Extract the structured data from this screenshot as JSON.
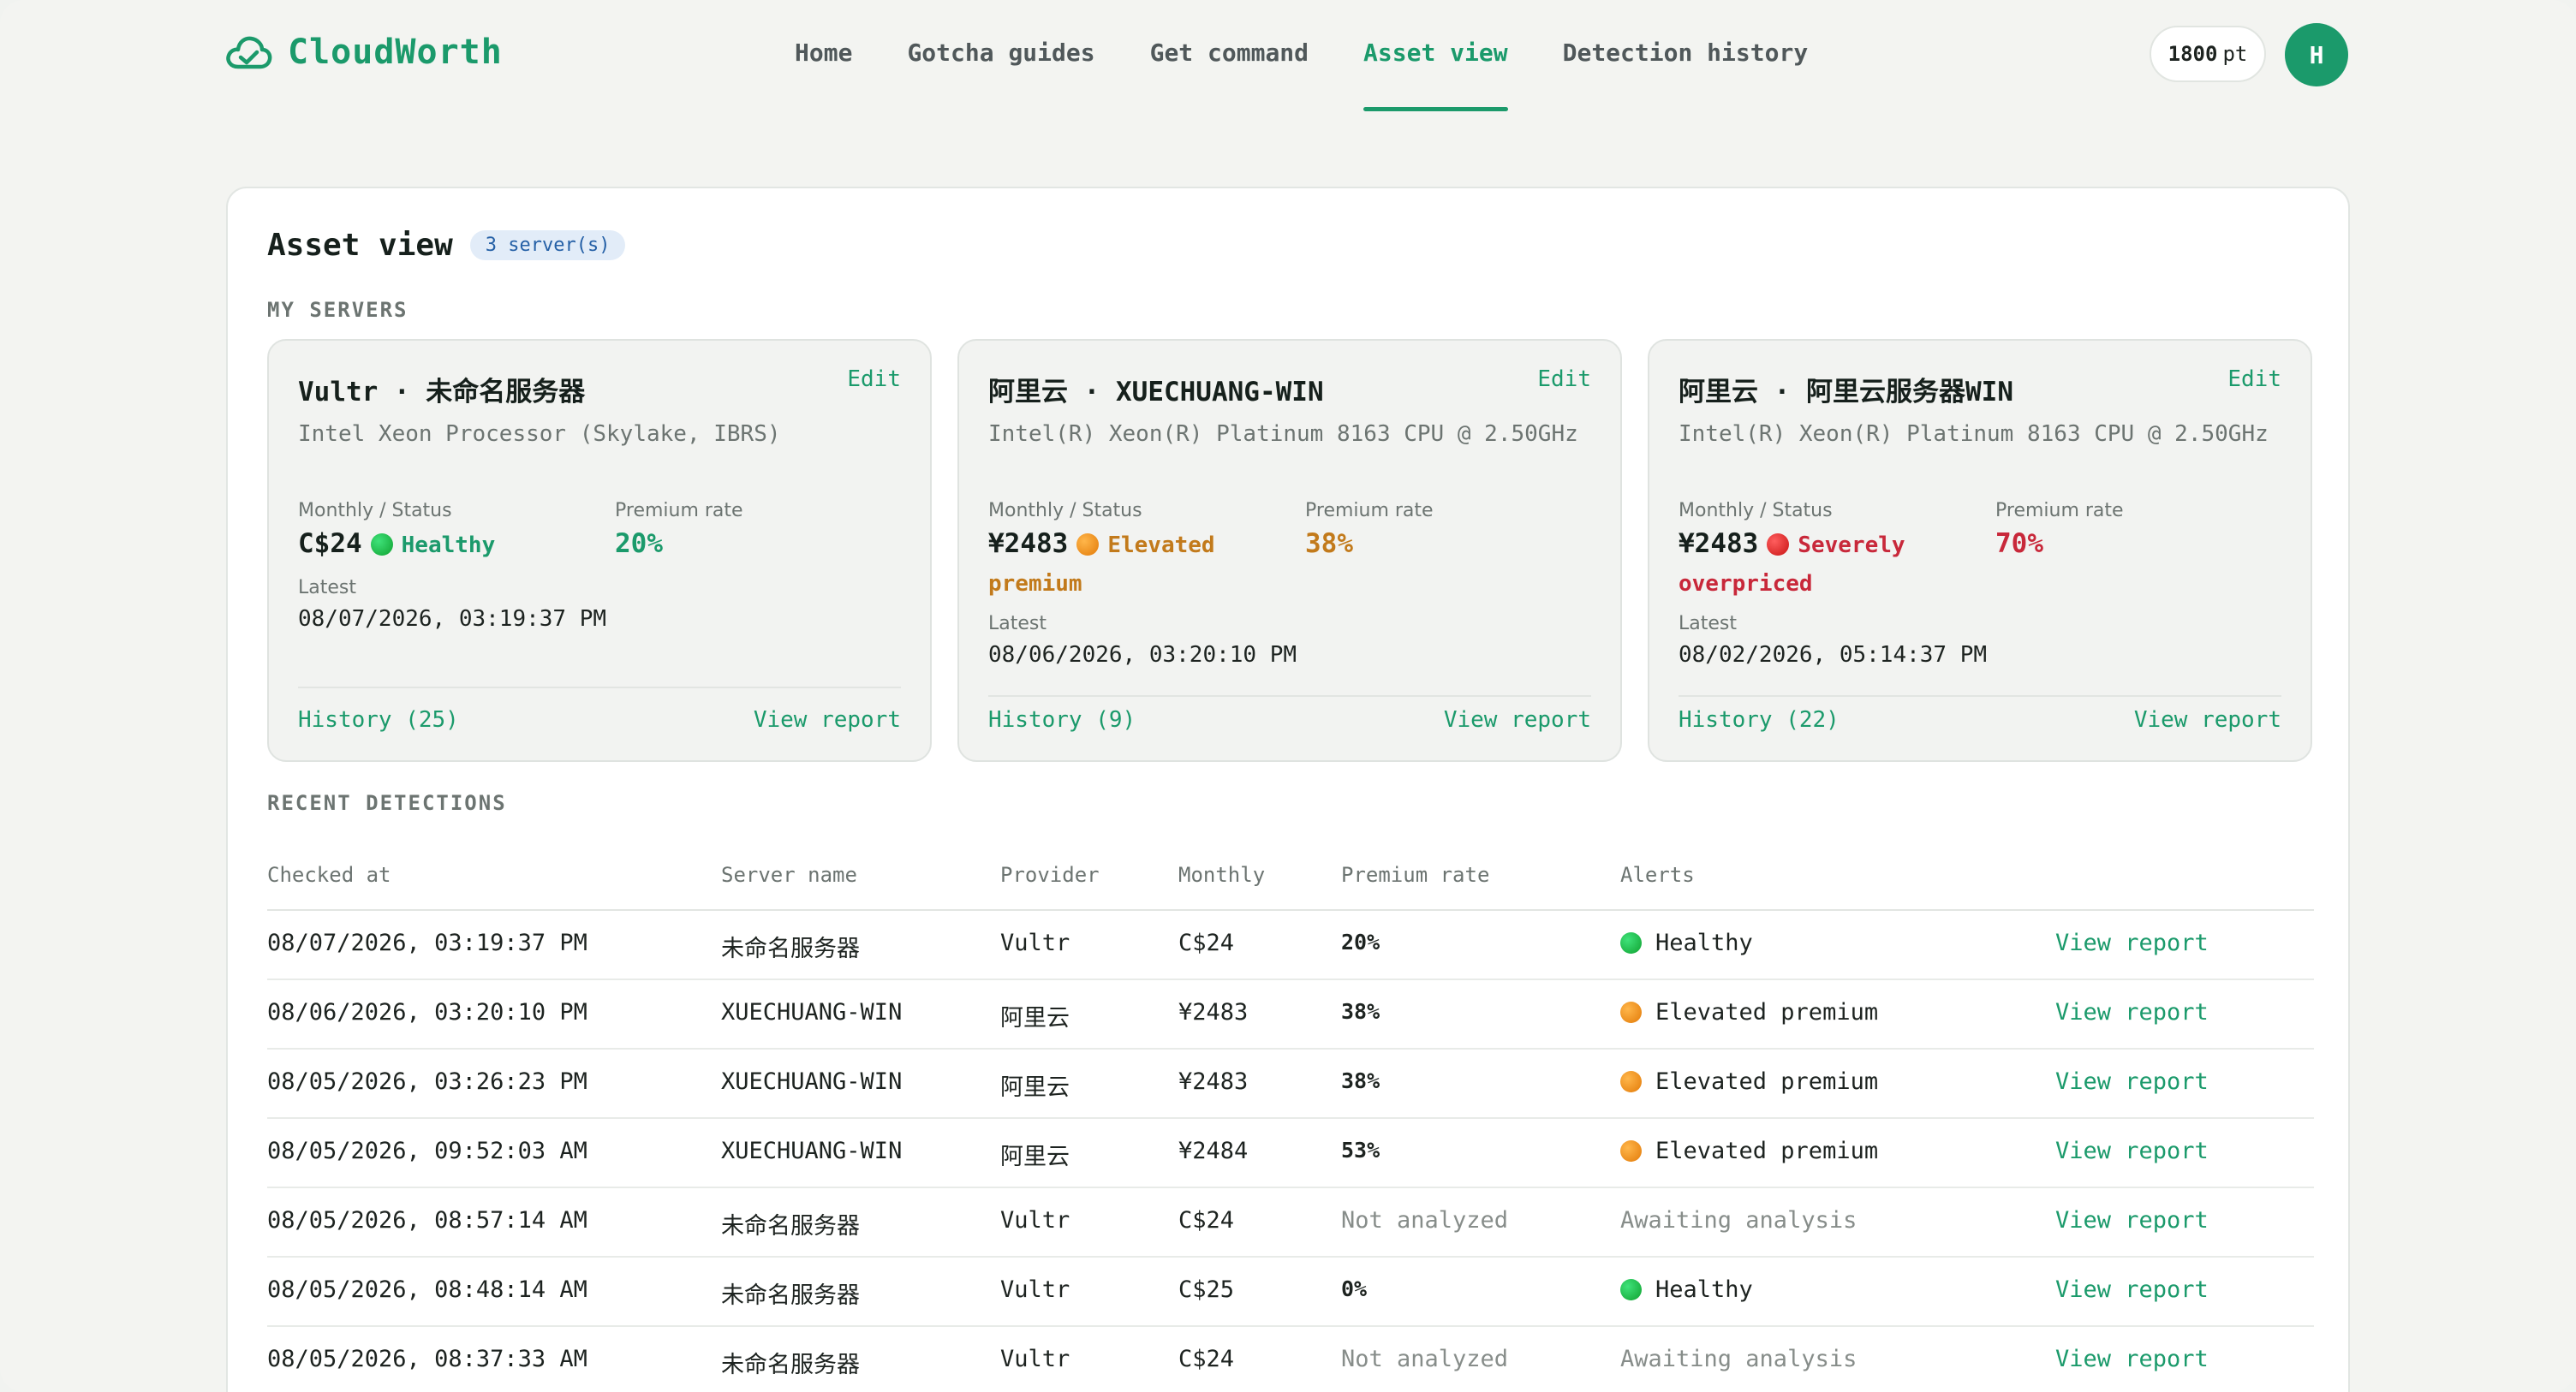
{
  "brand": {
    "name": "CloudWorth",
    "icon": "cloud-check-icon"
  },
  "nav": {
    "items": [
      {
        "label": "Home"
      },
      {
        "label": "Gotcha guides"
      },
      {
        "label": "Get command"
      },
      {
        "label": "Asset view",
        "active": true
      },
      {
        "label": "Detection history"
      }
    ]
  },
  "user": {
    "points": "1800",
    "points_unit": "pt",
    "avatar_initial": "H"
  },
  "page": {
    "title": "Asset view",
    "server_count": "3 server(s)",
    "my_servers_label": "MY SERVERS",
    "recent_label": "RECENT DETECTIONS"
  },
  "colors": {
    "accent": "#1b9a6b",
    "healthy": "#1b9a6b",
    "elevated": "#c27a1b",
    "severe": "#c8283a"
  },
  "labels": {
    "monthly_status": "Monthly / Status",
    "premium_rate": "Premium rate",
    "latest": "Latest",
    "edit": "Edit",
    "view_report": "View report"
  },
  "servers": [
    {
      "title": "Vultr · 未命名服务器",
      "cpu": "Intel Xeon Processor (Skylake, IBRS)",
      "price": "C$24",
      "status_line1": "Healthy",
      "status_line2": "",
      "status_level": "healthy",
      "premium_rate": "20%",
      "latest": "08/07/2026, 03:19:37 PM",
      "history": "History (25)"
    },
    {
      "title": "阿里云 · XUECHUANG-WIN",
      "cpu": "Intel(R) Xeon(R) Platinum 8163 CPU @ 2.50GHz",
      "price": "¥2483",
      "status_line1": "Elevated",
      "status_line2": "premium",
      "status_level": "elevated",
      "premium_rate": "38%",
      "latest": "08/06/2026, 03:20:10 PM",
      "history": "History (9)"
    },
    {
      "title": "阿里云 · 阿里云服务器WIN",
      "cpu": "Intel(R) Xeon(R) Platinum 8163 CPU @ 2.50GHz",
      "price": "¥2483",
      "status_line1": "Severely",
      "status_line2": "overpriced",
      "status_level": "severe",
      "premium_rate": "70%",
      "latest": "08/02/2026, 05:14:37 PM",
      "history": "History (22)"
    }
  ],
  "table": {
    "columns": [
      "Checked at",
      "Server name",
      "Provider",
      "Monthly",
      "Premium rate",
      "Alerts"
    ],
    "rows": [
      {
        "checked_at": "08/07/2026, 03:19:37 PM",
        "server": "未命名服务器",
        "provider": "Vultr",
        "monthly": "C$24",
        "rate": "20%",
        "alert": "Healthy",
        "level": "healthy",
        "action": "View report"
      },
      {
        "checked_at": "08/06/2026, 03:20:10 PM",
        "server": "XUECHUANG-WIN",
        "provider": "阿里云",
        "monthly": "¥2483",
        "rate": "38%",
        "alert": "Elevated premium",
        "level": "elevated",
        "action": "View report"
      },
      {
        "checked_at": "08/05/2026, 03:26:23 PM",
        "server": "XUECHUANG-WIN",
        "provider": "阿里云",
        "monthly": "¥2483",
        "rate": "38%",
        "alert": "Elevated premium",
        "level": "elevated",
        "action": "View report"
      },
      {
        "checked_at": "08/05/2026, 09:52:03 AM",
        "server": "XUECHUANG-WIN",
        "provider": "阿里云",
        "monthly": "¥2484",
        "rate": "53%",
        "alert": "Elevated premium",
        "level": "elevated",
        "action": "View report"
      },
      {
        "checked_at": "08/05/2026, 08:57:14 AM",
        "server": "未命名服务器",
        "provider": "Vultr",
        "monthly": "C$24",
        "rate": "Not analyzed",
        "alert": "Awaiting analysis",
        "level": "none",
        "action": "View report"
      },
      {
        "checked_at": "08/05/2026, 08:48:14 AM",
        "server": "未命名服务器",
        "provider": "Vultr",
        "monthly": "C$25",
        "rate": "0%",
        "alert": "Healthy",
        "level": "healthy",
        "action": "View report"
      },
      {
        "checked_at": "08/05/2026, 08:37:33 AM",
        "server": "未命名服务器",
        "provider": "Vultr",
        "monthly": "C$24",
        "rate": "Not analyzed",
        "alert": "Awaiting analysis",
        "level": "none",
        "action": "View report"
      }
    ]
  }
}
